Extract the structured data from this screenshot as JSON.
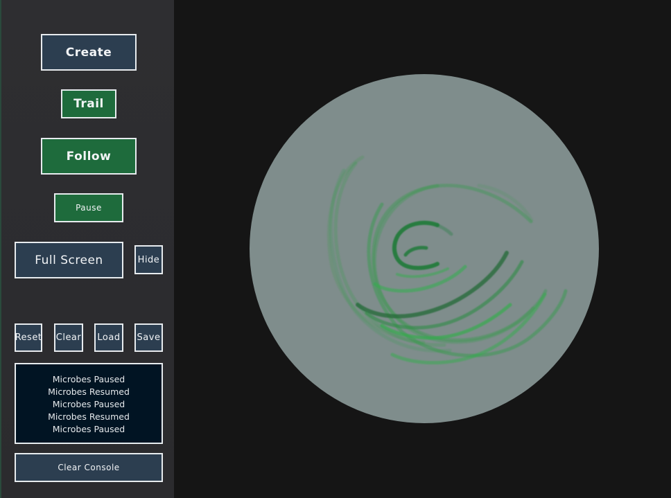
{
  "sidebar": {
    "create_label": "Create",
    "trail_label": "Trail",
    "follow_label": "Follow",
    "pause_label": "Pause",
    "fullscreen_label": "Full Screen",
    "hide_label": "Hide",
    "reset_label": "Reset",
    "clear_label": "Clear",
    "load_label": "Load",
    "save_label": "Save",
    "clear_console_label": "Clear Console"
  },
  "console": {
    "lines": [
      "Microbes Paused",
      "Microbes Resumed",
      "Microbes Paused",
      "Microbes Resumed",
      "Microbes Paused"
    ]
  },
  "colors": {
    "button_blue": "#2c3e50",
    "button_green": "#1e6b3c",
    "console_bg": "#011423",
    "dish": "#7f8d8c",
    "trail_green": "#2a9a3e"
  }
}
